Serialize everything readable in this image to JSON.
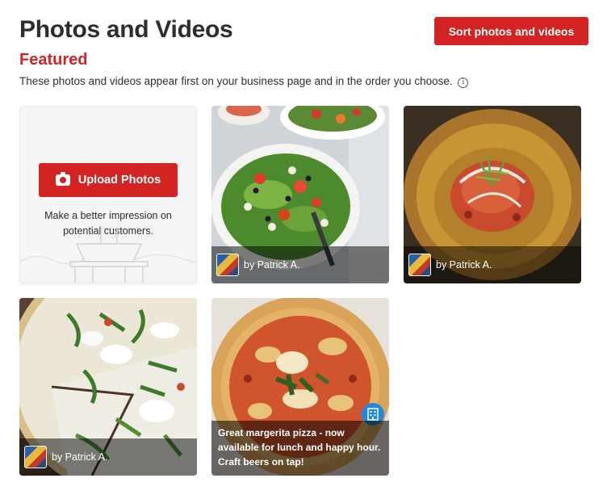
{
  "header": {
    "title": "Photos and Videos",
    "section": "Featured",
    "description": "These photos and videos appear first on your business page and in the order you choose.",
    "info_icon": "i",
    "sort_button": "Sort photos and videos"
  },
  "upload": {
    "button_label": "Upload Photos",
    "hint": "Make a better impression on potential customers."
  },
  "photos": [
    {
      "subject": "salad",
      "caption": "by Patrick A."
    },
    {
      "subject": "plated dish",
      "caption": "by Patrick A."
    },
    {
      "subject": "white pizza with arugula",
      "caption": "by Patrick A."
    },
    {
      "subject": "margherita pizza",
      "caption": "Great margerita pizza - now available for lunch and happy hour.   Craft beers on tap!"
    }
  ],
  "colors": {
    "brand_red": "#d32323",
    "badge_blue": "#1e88e5"
  }
}
